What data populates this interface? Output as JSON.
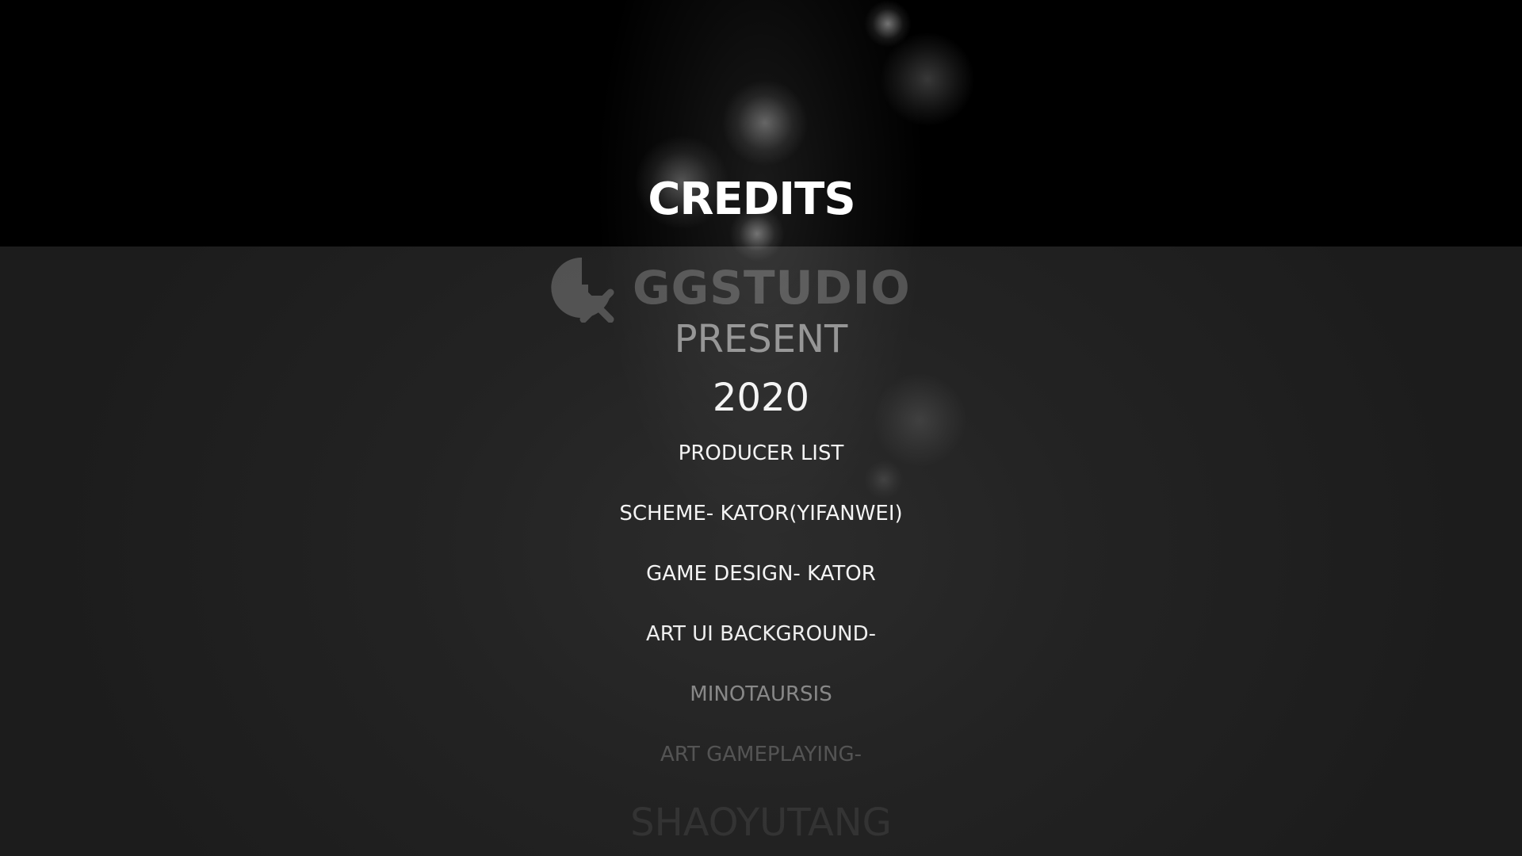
{
  "screen": {
    "title": "CREDITS",
    "studio": {
      "name": "GGSTUDIO",
      "logo_icon": "ggstudio-logo-icon"
    },
    "credits": {
      "present": "PRESENT",
      "year": "2020",
      "producer_list": "PRODUCER LIST",
      "scheme": "SCHEME- KATOR(YIFANWEI)",
      "game_design": "GAME DESIGN- KATOR",
      "art_ui_background": "ART UI BACKGROUND-",
      "art_ui_background_name": "MINOTAURSIS",
      "art_gameplaying": "ART GAMEPLAYING-",
      "art_gameplaying_name": "SHAOYUTANG"
    }
  },
  "colors": {
    "top_band": "#000000",
    "panel": "#232323",
    "text": "#ffffff"
  }
}
